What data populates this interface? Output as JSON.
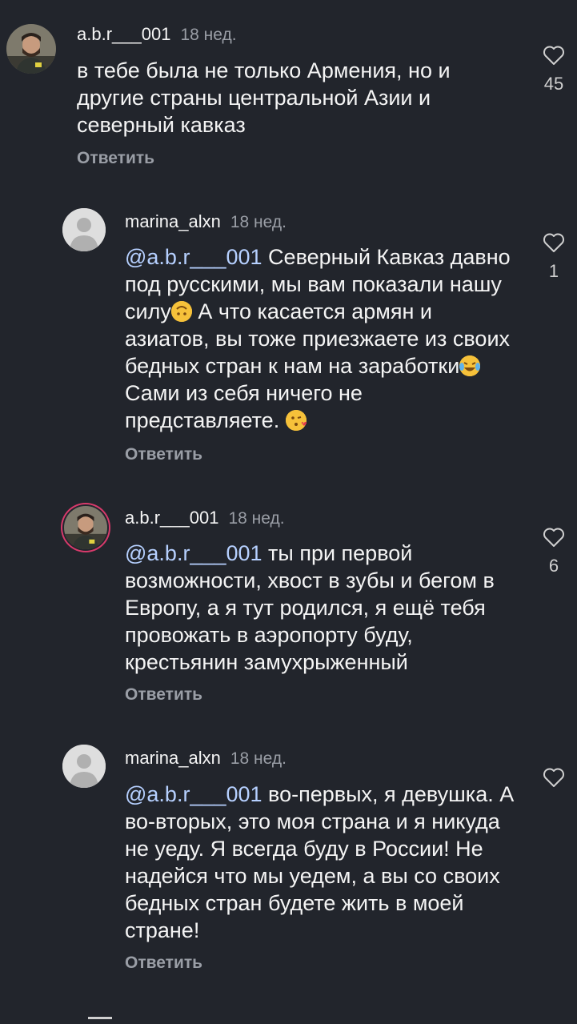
{
  "comments": [
    {
      "username": "a.b.r___001",
      "time": "18 нед.",
      "text": "в тебе была не только Армения, но и другие страны центральной Азии и северный кавказ",
      "reply": "Ответить",
      "likes": "45"
    },
    {
      "username": "marina_alxn",
      "time": "18 нед.",
      "mention": "@a.b.r___001",
      "text_parts": [
        " Северный Кавказ давно под русскими, мы вам показали нашу силу",
        " А что касается армян и азиатов, вы тоже приезжаете из своих бедных стран к нам на заработки",
        "Сами из себя ничего не представляете. "
      ],
      "reply": "Ответить",
      "likes": "1"
    },
    {
      "username": "a.b.r___001",
      "time": "18 нед.",
      "mention": "@a.b.r___001",
      "text": " ты при первой возможности, хвост в зубы и бегом в Европу, а я тут родился, я ещё тебя провожать в аэропорту буду, крестьянин замухрыженный",
      "reply": "Ответить",
      "likes": "6"
    },
    {
      "username": "marina_alxn",
      "time": "18 нед.",
      "mention": "@a.b.r___001",
      "text": " во-первых, я девушка. А во-вторых, это моя страна и я никуда не уеду. Я всегда буду в России! Не надейся что мы уедем, а вы со своих бедных стран будете жить в моей стране!",
      "reply": "Ответить",
      "likes": ""
    }
  ],
  "icons": {
    "like": "heart-outline-icon",
    "default_avatar": "default-user-avatar-icon",
    "emoji_1": "upside-down-smile-emoji",
    "emoji_2": "tears-of-joy-emoji",
    "emoji_3": "kissing-heart-emoji"
  },
  "colors": {
    "background": "#22252c",
    "mention": "#b6d0ff",
    "secondary_text": "#9a9ea6",
    "story_ring": "#d83a6b"
  }
}
